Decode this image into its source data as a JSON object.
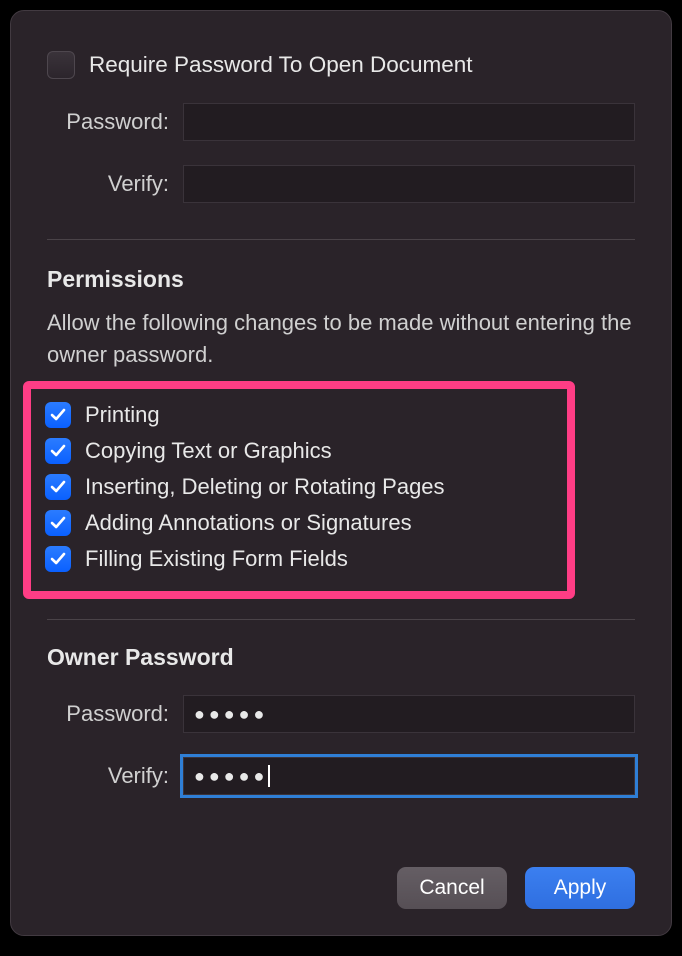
{
  "require": {
    "checkbox_checked": false,
    "label": "Require Password To Open Document",
    "password_label": "Password:",
    "password_value": "",
    "verify_label": "Verify:",
    "verify_value": ""
  },
  "permissions": {
    "title": "Permissions",
    "intro": "Allow the following changes to be made without entering the owner password.",
    "items": [
      {
        "label": "Printing",
        "checked": true
      },
      {
        "label": "Copying Text or Graphics",
        "checked": true
      },
      {
        "label": "Inserting, Deleting or Rotating Pages",
        "checked": true
      },
      {
        "label": "Adding Annotations or Signatures",
        "checked": true
      },
      {
        "label": "Filling Existing Form Fields",
        "checked": true
      }
    ]
  },
  "owner": {
    "title": "Owner Password",
    "password_label": "Password:",
    "password_mask": "●●●●●",
    "verify_label": "Verify:",
    "verify_mask": "●●●●●",
    "verify_focused": true
  },
  "footer": {
    "cancel": "Cancel",
    "apply": "Apply"
  },
  "colors": {
    "highlight": "#ff3d85",
    "checkbox": "#0a60ff",
    "primary_button": "#2f6fe0"
  }
}
